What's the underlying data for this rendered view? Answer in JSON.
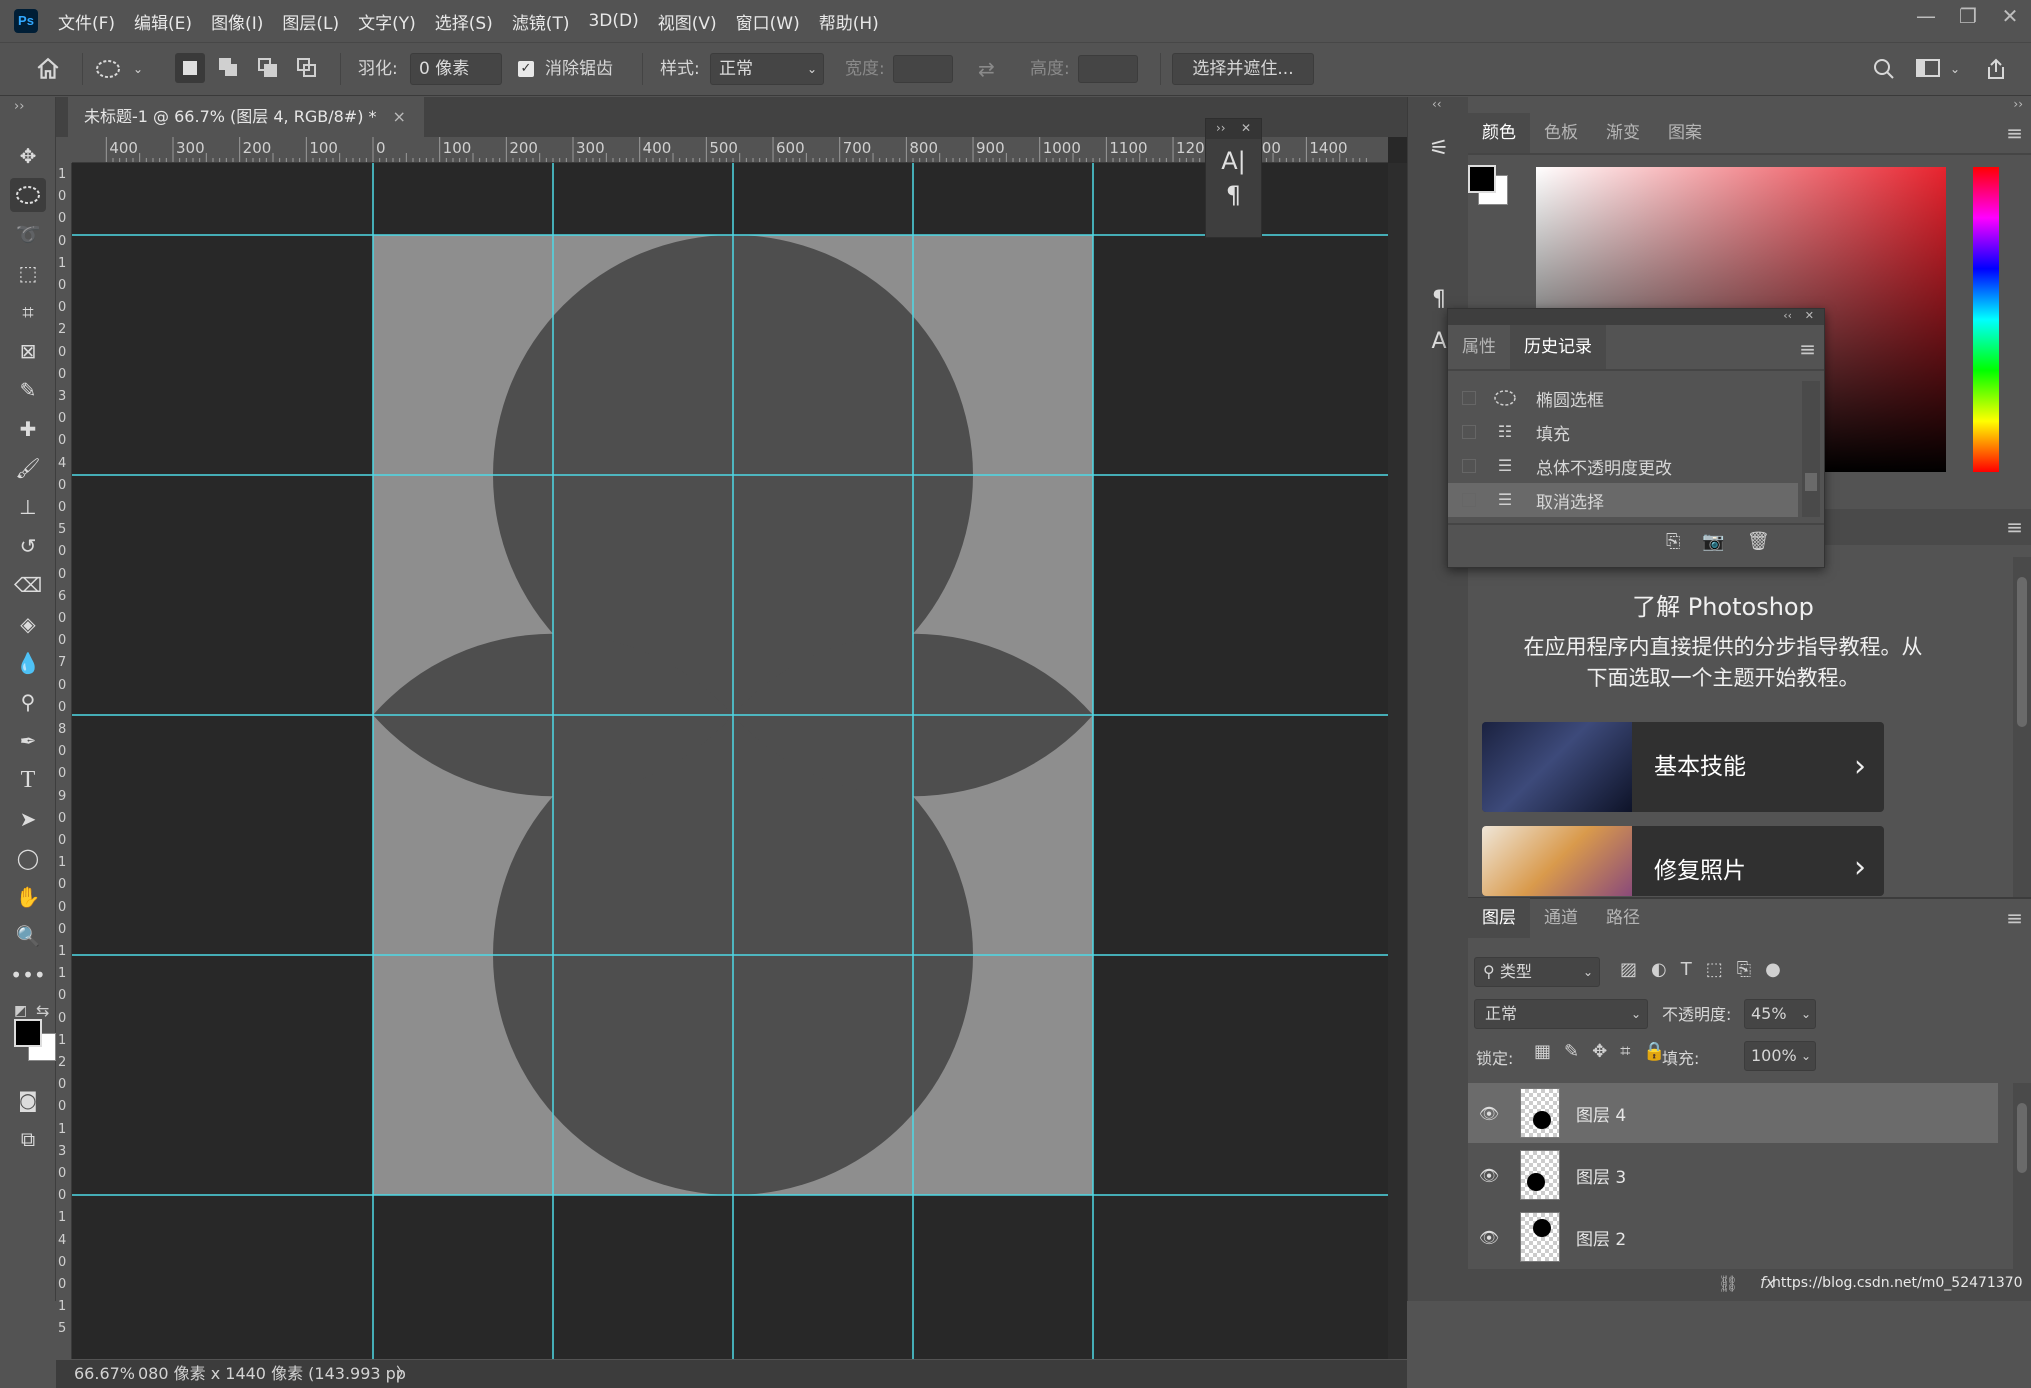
{
  "app": {
    "logo": "Ps"
  },
  "menu": [
    "文件(F)",
    "编辑(E)",
    "图像(I)",
    "图层(L)",
    "文字(Y)",
    "选择(S)",
    "滤镜(T)",
    "3D(D)",
    "视图(V)",
    "窗口(W)",
    "帮助(H)"
  ],
  "window_controls": [
    "—",
    "❐",
    "✕"
  ],
  "options": {
    "feather_label": "羽化:",
    "feather_value": "0 像素",
    "antialias_label": "消除锯齿",
    "antialias_checked": true,
    "style_label": "样式:",
    "style_value": "正常",
    "width_label": "宽度:",
    "height_label": "高度:",
    "select_mask_button": "选择并遮住..."
  },
  "document": {
    "tab_title": "未标题-1 @ 66.7% (图层 4, RGB/8#) *",
    "tab_close": "×",
    "ruler_labels": [
      "400",
      "300",
      "200",
      "100",
      "0",
      "100",
      "200",
      "300",
      "400",
      "500",
      "600",
      "700",
      "800",
      "900",
      "1000",
      "1100",
      "1200",
      "1300",
      "1400"
    ],
    "vruler_labels": [
      "1",
      "0",
      "0",
      "0",
      "1",
      "0",
      "0",
      "2",
      "0",
      "0",
      "3",
      "0",
      "0",
      "4",
      "0",
      "0",
      "5",
      "0",
      "0",
      "6",
      "0",
      "0",
      "7",
      "0",
      "0",
      "8",
      "0",
      "0",
      "9",
      "0",
      "0",
      "1",
      "0",
      "0",
      "0",
      "1",
      "1",
      "0",
      "0",
      "1",
      "2",
      "0",
      "0",
      "1",
      "3",
      "0",
      "0",
      "1",
      "4",
      "0",
      "0",
      "1",
      "5"
    ]
  },
  "status": {
    "zoom": "66.67%",
    "info": "080 像素 x 1440 像素 (143.993 pp",
    "arrow": "〉"
  },
  "char_panel": {
    "glyph1": "A|",
    "glyph2": "¶",
    "expand": "››",
    "close": "✕"
  },
  "colors": {
    "guide": "#4fd9e6",
    "canvas_bg": "#282828",
    "doc_light": "#8e8e8e",
    "shape_dark": "#4e4e4e",
    "accent": "#31a8ff"
  },
  "color_panel": {
    "tabs": [
      "颜色",
      "色板",
      "渐变",
      "图案"
    ],
    "active": 0
  },
  "history_panel": {
    "tabs": [
      "属性",
      "历史记录"
    ],
    "active": 1,
    "items": [
      {
        "icon": "ellipse-select-icon",
        "label": "椭圆选框"
      },
      {
        "icon": "fill-icon",
        "label": "填充"
      },
      {
        "icon": "document-icon",
        "label": "总体不透明度更改"
      },
      {
        "icon": "document-icon",
        "label": "取消选择"
      }
    ]
  },
  "learn_panel": {
    "title": "了解 Photoshop",
    "desc1": "在应用程序内直接提供的分步指导教程。从",
    "desc2": "下面选取一个主题开始教程。",
    "cards": [
      {
        "label": "基本技能",
        "arrow": "›"
      },
      {
        "label": "修复照片",
        "arrow": "›"
      }
    ]
  },
  "layers_panel": {
    "tabs": [
      "图层",
      "通道",
      "路径"
    ],
    "active": 0,
    "filter_label": "类型",
    "blend_mode": "正常",
    "opacity_label": "不透明度:",
    "opacity_value": "45%",
    "lock_label": "锁定:",
    "fill_label": "填充:",
    "fill_value": "100%",
    "layers": [
      {
        "name": "图层 4",
        "selected": true
      },
      {
        "name": "图层 3",
        "selected": false
      },
      {
        "name": "图层 2",
        "selected": false
      }
    ],
    "watermark": "https://blog.csdn.net/m0_52471370",
    "fx_label": "fx"
  }
}
